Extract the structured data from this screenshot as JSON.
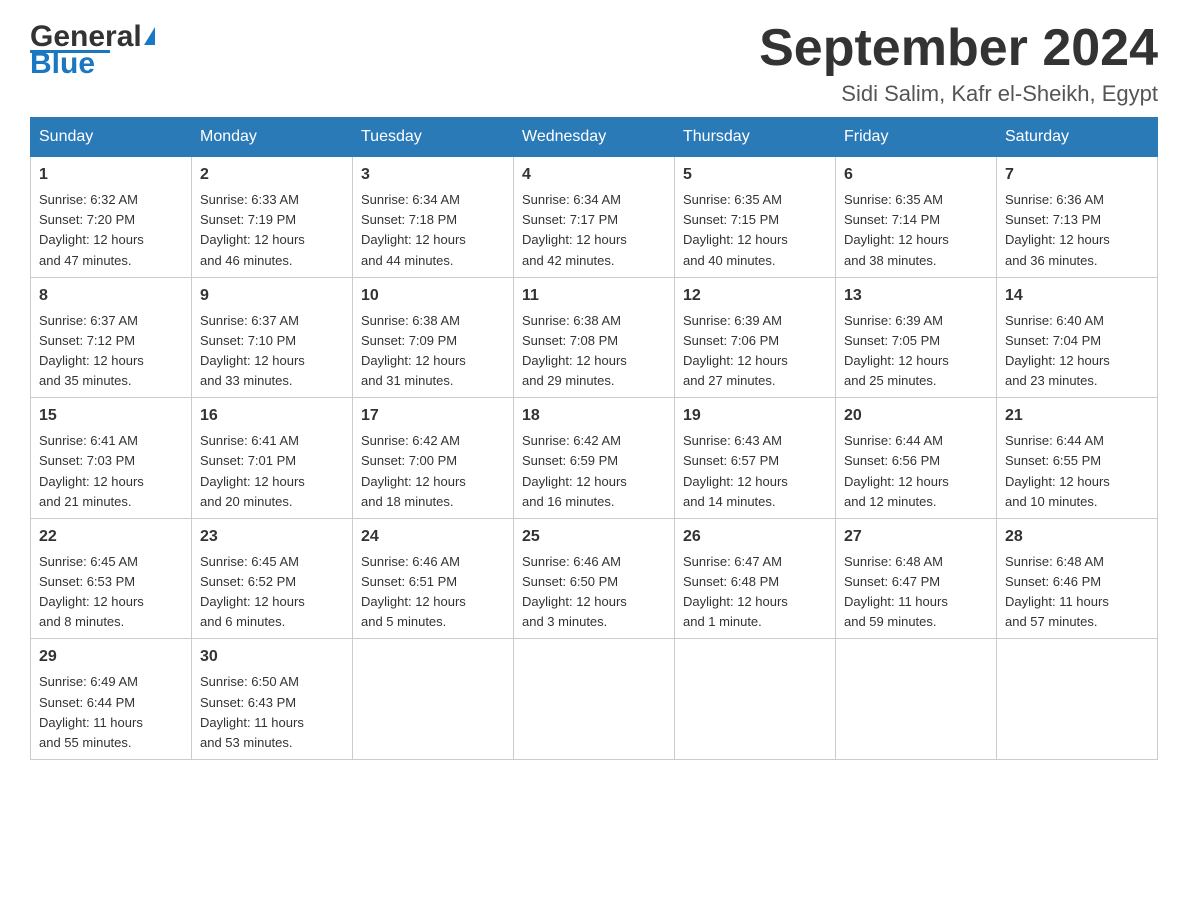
{
  "header": {
    "logo_general": "General",
    "logo_blue": "Blue",
    "month_title": "September 2024",
    "location": "Sidi Salim, Kafr el-Sheikh, Egypt"
  },
  "weekdays": [
    "Sunday",
    "Monday",
    "Tuesday",
    "Wednesday",
    "Thursday",
    "Friday",
    "Saturday"
  ],
  "weeks": [
    [
      {
        "day": "1",
        "sunrise": "6:32 AM",
        "sunset": "7:20 PM",
        "daylight": "12 hours and 47 minutes."
      },
      {
        "day": "2",
        "sunrise": "6:33 AM",
        "sunset": "7:19 PM",
        "daylight": "12 hours and 46 minutes."
      },
      {
        "day": "3",
        "sunrise": "6:34 AM",
        "sunset": "7:18 PM",
        "daylight": "12 hours and 44 minutes."
      },
      {
        "day": "4",
        "sunrise": "6:34 AM",
        "sunset": "7:17 PM",
        "daylight": "12 hours and 42 minutes."
      },
      {
        "day": "5",
        "sunrise": "6:35 AM",
        "sunset": "7:15 PM",
        "daylight": "12 hours and 40 minutes."
      },
      {
        "day": "6",
        "sunrise": "6:35 AM",
        "sunset": "7:14 PM",
        "daylight": "12 hours and 38 minutes."
      },
      {
        "day": "7",
        "sunrise": "6:36 AM",
        "sunset": "7:13 PM",
        "daylight": "12 hours and 36 minutes."
      }
    ],
    [
      {
        "day": "8",
        "sunrise": "6:37 AM",
        "sunset": "7:12 PM",
        "daylight": "12 hours and 35 minutes."
      },
      {
        "day": "9",
        "sunrise": "6:37 AM",
        "sunset": "7:10 PM",
        "daylight": "12 hours and 33 minutes."
      },
      {
        "day": "10",
        "sunrise": "6:38 AM",
        "sunset": "7:09 PM",
        "daylight": "12 hours and 31 minutes."
      },
      {
        "day": "11",
        "sunrise": "6:38 AM",
        "sunset": "7:08 PM",
        "daylight": "12 hours and 29 minutes."
      },
      {
        "day": "12",
        "sunrise": "6:39 AM",
        "sunset": "7:06 PM",
        "daylight": "12 hours and 27 minutes."
      },
      {
        "day": "13",
        "sunrise": "6:39 AM",
        "sunset": "7:05 PM",
        "daylight": "12 hours and 25 minutes."
      },
      {
        "day": "14",
        "sunrise": "6:40 AM",
        "sunset": "7:04 PM",
        "daylight": "12 hours and 23 minutes."
      }
    ],
    [
      {
        "day": "15",
        "sunrise": "6:41 AM",
        "sunset": "7:03 PM",
        "daylight": "12 hours and 21 minutes."
      },
      {
        "day": "16",
        "sunrise": "6:41 AM",
        "sunset": "7:01 PM",
        "daylight": "12 hours and 20 minutes."
      },
      {
        "day": "17",
        "sunrise": "6:42 AM",
        "sunset": "7:00 PM",
        "daylight": "12 hours and 18 minutes."
      },
      {
        "day": "18",
        "sunrise": "6:42 AM",
        "sunset": "6:59 PM",
        "daylight": "12 hours and 16 minutes."
      },
      {
        "day": "19",
        "sunrise": "6:43 AM",
        "sunset": "6:57 PM",
        "daylight": "12 hours and 14 minutes."
      },
      {
        "day": "20",
        "sunrise": "6:44 AM",
        "sunset": "6:56 PM",
        "daylight": "12 hours and 12 minutes."
      },
      {
        "day": "21",
        "sunrise": "6:44 AM",
        "sunset": "6:55 PM",
        "daylight": "12 hours and 10 minutes."
      }
    ],
    [
      {
        "day": "22",
        "sunrise": "6:45 AM",
        "sunset": "6:53 PM",
        "daylight": "12 hours and 8 minutes."
      },
      {
        "day": "23",
        "sunrise": "6:45 AM",
        "sunset": "6:52 PM",
        "daylight": "12 hours and 6 minutes."
      },
      {
        "day": "24",
        "sunrise": "6:46 AM",
        "sunset": "6:51 PM",
        "daylight": "12 hours and 5 minutes."
      },
      {
        "day": "25",
        "sunrise": "6:46 AM",
        "sunset": "6:50 PM",
        "daylight": "12 hours and 3 minutes."
      },
      {
        "day": "26",
        "sunrise": "6:47 AM",
        "sunset": "6:48 PM",
        "daylight": "12 hours and 1 minute."
      },
      {
        "day": "27",
        "sunrise": "6:48 AM",
        "sunset": "6:47 PM",
        "daylight": "11 hours and 59 minutes."
      },
      {
        "day": "28",
        "sunrise": "6:48 AM",
        "sunset": "6:46 PM",
        "daylight": "11 hours and 57 minutes."
      }
    ],
    [
      {
        "day": "29",
        "sunrise": "6:49 AM",
        "sunset": "6:44 PM",
        "daylight": "11 hours and 55 minutes."
      },
      {
        "day": "30",
        "sunrise": "6:50 AM",
        "sunset": "6:43 PM",
        "daylight": "11 hours and 53 minutes."
      },
      null,
      null,
      null,
      null,
      null
    ]
  ],
  "labels": {
    "sunrise": "Sunrise:",
    "sunset": "Sunset:",
    "daylight": "Daylight:"
  }
}
